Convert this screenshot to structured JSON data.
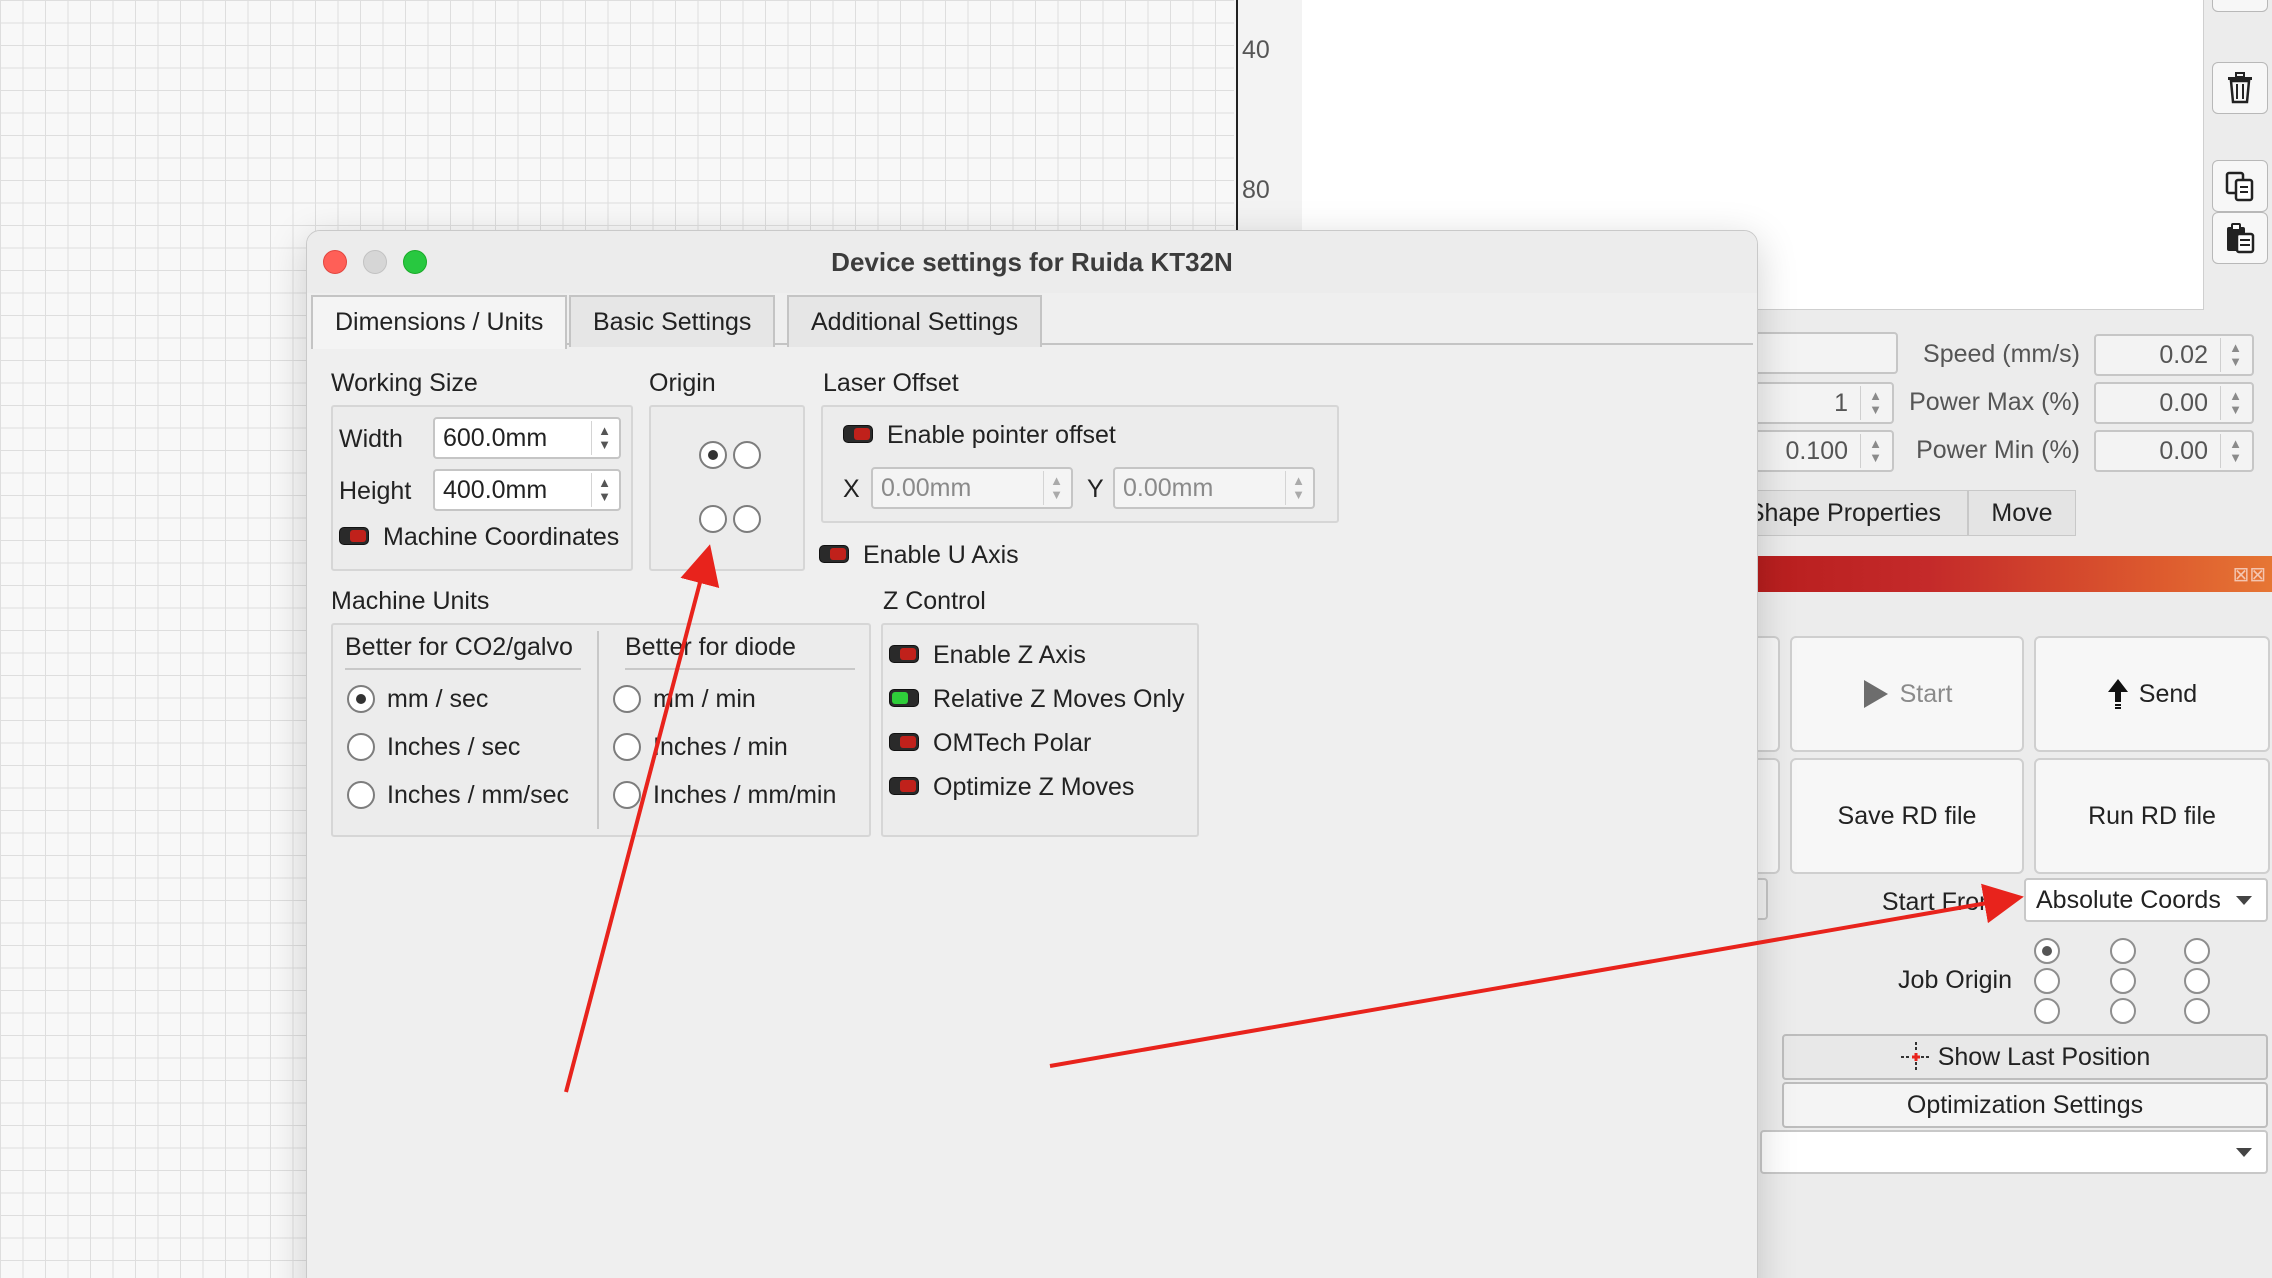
{
  "dialog": {
    "title": "Device settings for Ruida KT32N",
    "tabs": [
      "Dimensions / Units",
      "Basic Settings",
      "Additional Settings"
    ],
    "working_size": {
      "label": "Working Size",
      "width_label": "Width",
      "width_value": "600.0mm",
      "height_label": "Height",
      "height_value": "400.0mm",
      "machine_coords_label": "Machine Coordinates"
    },
    "origin": {
      "label": "Origin"
    },
    "laser_offset": {
      "label": "Laser Offset",
      "enable_label": "Enable pointer offset",
      "x_label": "X",
      "x_value": "0.00mm",
      "y_label": "Y",
      "y_value": "0.00mm"
    },
    "enable_u_axis": "Enable U Axis",
    "machine_units": {
      "label": "Machine Units",
      "co2_header": "Better for CO2/galvo",
      "diode_header": "Better for diode",
      "co2_options": [
        "mm / sec",
        "Inches / sec",
        "Inches / mm/sec"
      ],
      "diode_options": [
        "mm / min",
        "Inches / min",
        "Inches / mm/min"
      ]
    },
    "z_control": {
      "label": "Z Control",
      "options": [
        "Enable Z Axis",
        "Relative Z Moves Only",
        "OMTech Polar",
        "Optimize Z Moves"
      ]
    }
  },
  "ruler": {
    "ticks": [
      "40",
      "80"
    ]
  },
  "right_panel": {
    "speed_label": "Speed (mm/s)",
    "speed_value": "0.02",
    "power_max_label": "Power Max (%)",
    "power_max_value": "0.00",
    "power_min_label": "Power Min (%)",
    "power_min_value": "0.00",
    "passes_value": "1",
    "interval_value": "0.100",
    "tabs": [
      "Shape Properties",
      "Move"
    ],
    "start_label": "Start",
    "send_label": "Send",
    "save_rd_label": "Save RD file",
    "run_rd_label": "Run RD file",
    "start_from_label": "Start From",
    "start_from_value": "Absolute Coords",
    "job_origin_label": "Job Origin",
    "show_last_position_label": "Show Last Position",
    "optimization_settings_label": "Optimization Settings"
  },
  "colors": {
    "toggle_off": "#c0211b",
    "toggle_on": "#2fce3a",
    "annotation_arrow": "#e8231c",
    "close": "#ff5f57",
    "maximize": "#28c840"
  },
  "icons": {
    "trash": "trash-icon",
    "copy": "copy-icon",
    "paste": "paste-icon",
    "start": "play-icon",
    "send": "upload-arrow-icon",
    "crosshair": "crosshair-icon"
  }
}
